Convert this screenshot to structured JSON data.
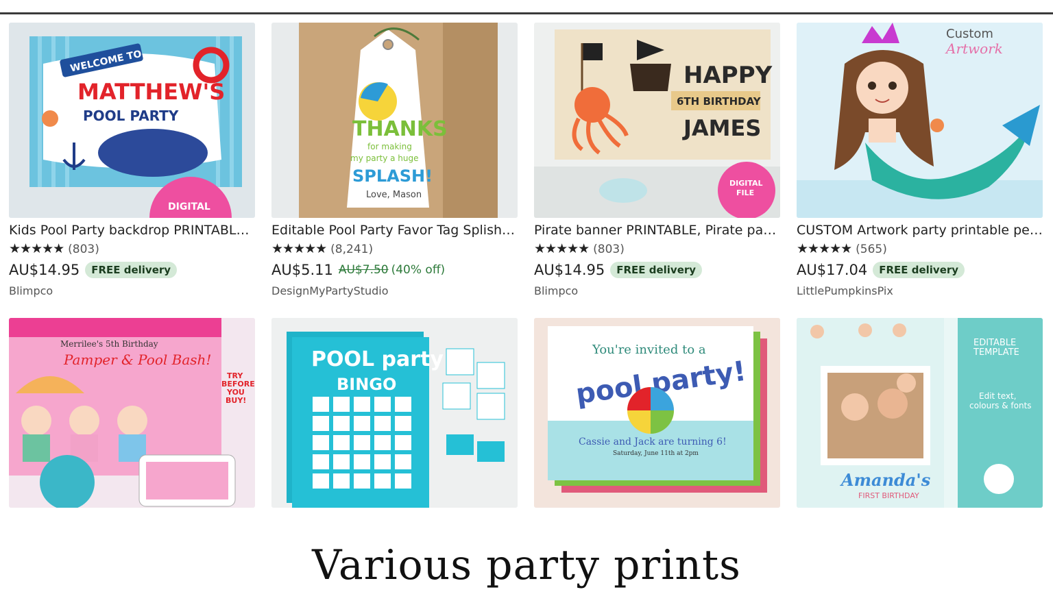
{
  "listings": [
    {
      "title": "Kids Pool Party backdrop PRINTABLE ...",
      "rating_stars": "★★★★★",
      "review_count": "(803)",
      "rating_value": 5,
      "price": "AU$14.95",
      "badge": "FREE delivery",
      "shop": "Blimpco",
      "image_text": {
        "line1": "WELCOME TO",
        "line2": "MATTHEW'S",
        "line3": "POOL PARTY",
        "stamp": "DIGITAL"
      }
    },
    {
      "title": "Editable Pool Party Favor Tag Splish S...",
      "rating_stars": "★★★★★",
      "review_count": "(8,241)",
      "rating_value": 5,
      "price": "AU$5.11",
      "original_price": "AU$7.50",
      "discount": "(40% off)",
      "shop": "DesignMyPartyStudio",
      "image_text": {
        "line1": "THANKS",
        "line2": "for making",
        "line3": "my party a huge",
        "line4": "SPLASH!",
        "line5": "Love, Mason"
      }
    },
    {
      "title": "Pirate banner PRINTABLE, Pirate party...",
      "rating_stars": "★★★★★",
      "review_count": "(803)",
      "rating_value": 5,
      "price": "AU$14.95",
      "badge": "FREE delivery",
      "shop": "Blimpco",
      "image_text": {
        "line1": "HAPPY",
        "line2": "6TH BIRTHDAY",
        "line3": "JAMES",
        "stamp1": "DIGITAL",
        "stamp2": "FILE"
      }
    },
    {
      "title": "CUSTOM Artwork party printable pers...",
      "rating_stars": "★★★★★",
      "review_count": "(565)",
      "rating_value": 5,
      "price": "AU$17.04",
      "badge": "FREE delivery",
      "shop": "LittlePumpkinsPix",
      "image_text": {
        "line1": "Custom",
        "line2": "Artwork"
      }
    }
  ],
  "gallery": [
    {
      "image_text": {
        "line1": "Merrilee's 5th Birthday",
        "line2": "Pamper & Pool Bash!",
        "line3": "TRY",
        "line4": "BEFORE",
        "line5": "YOU",
        "line6": "BUY!"
      }
    },
    {
      "image_text": {
        "line1": "POOL party",
        "line2": "BINGO"
      }
    },
    {
      "image_text": {
        "line1": "You're invited to a",
        "line2": "pool party!",
        "line3": "Cassie and Jack are turning 6!",
        "line4": "Saturday, June 11th at 2pm"
      }
    },
    {
      "image_text": {
        "line1": "EDITABLE",
        "line2": "TEMPLATE",
        "line3": "Edit text,",
        "line4": "colours & fonts",
        "line5": "Amanda's",
        "line6": "FIRST BIRTHDAY"
      }
    }
  ],
  "caption": "Various party prints"
}
